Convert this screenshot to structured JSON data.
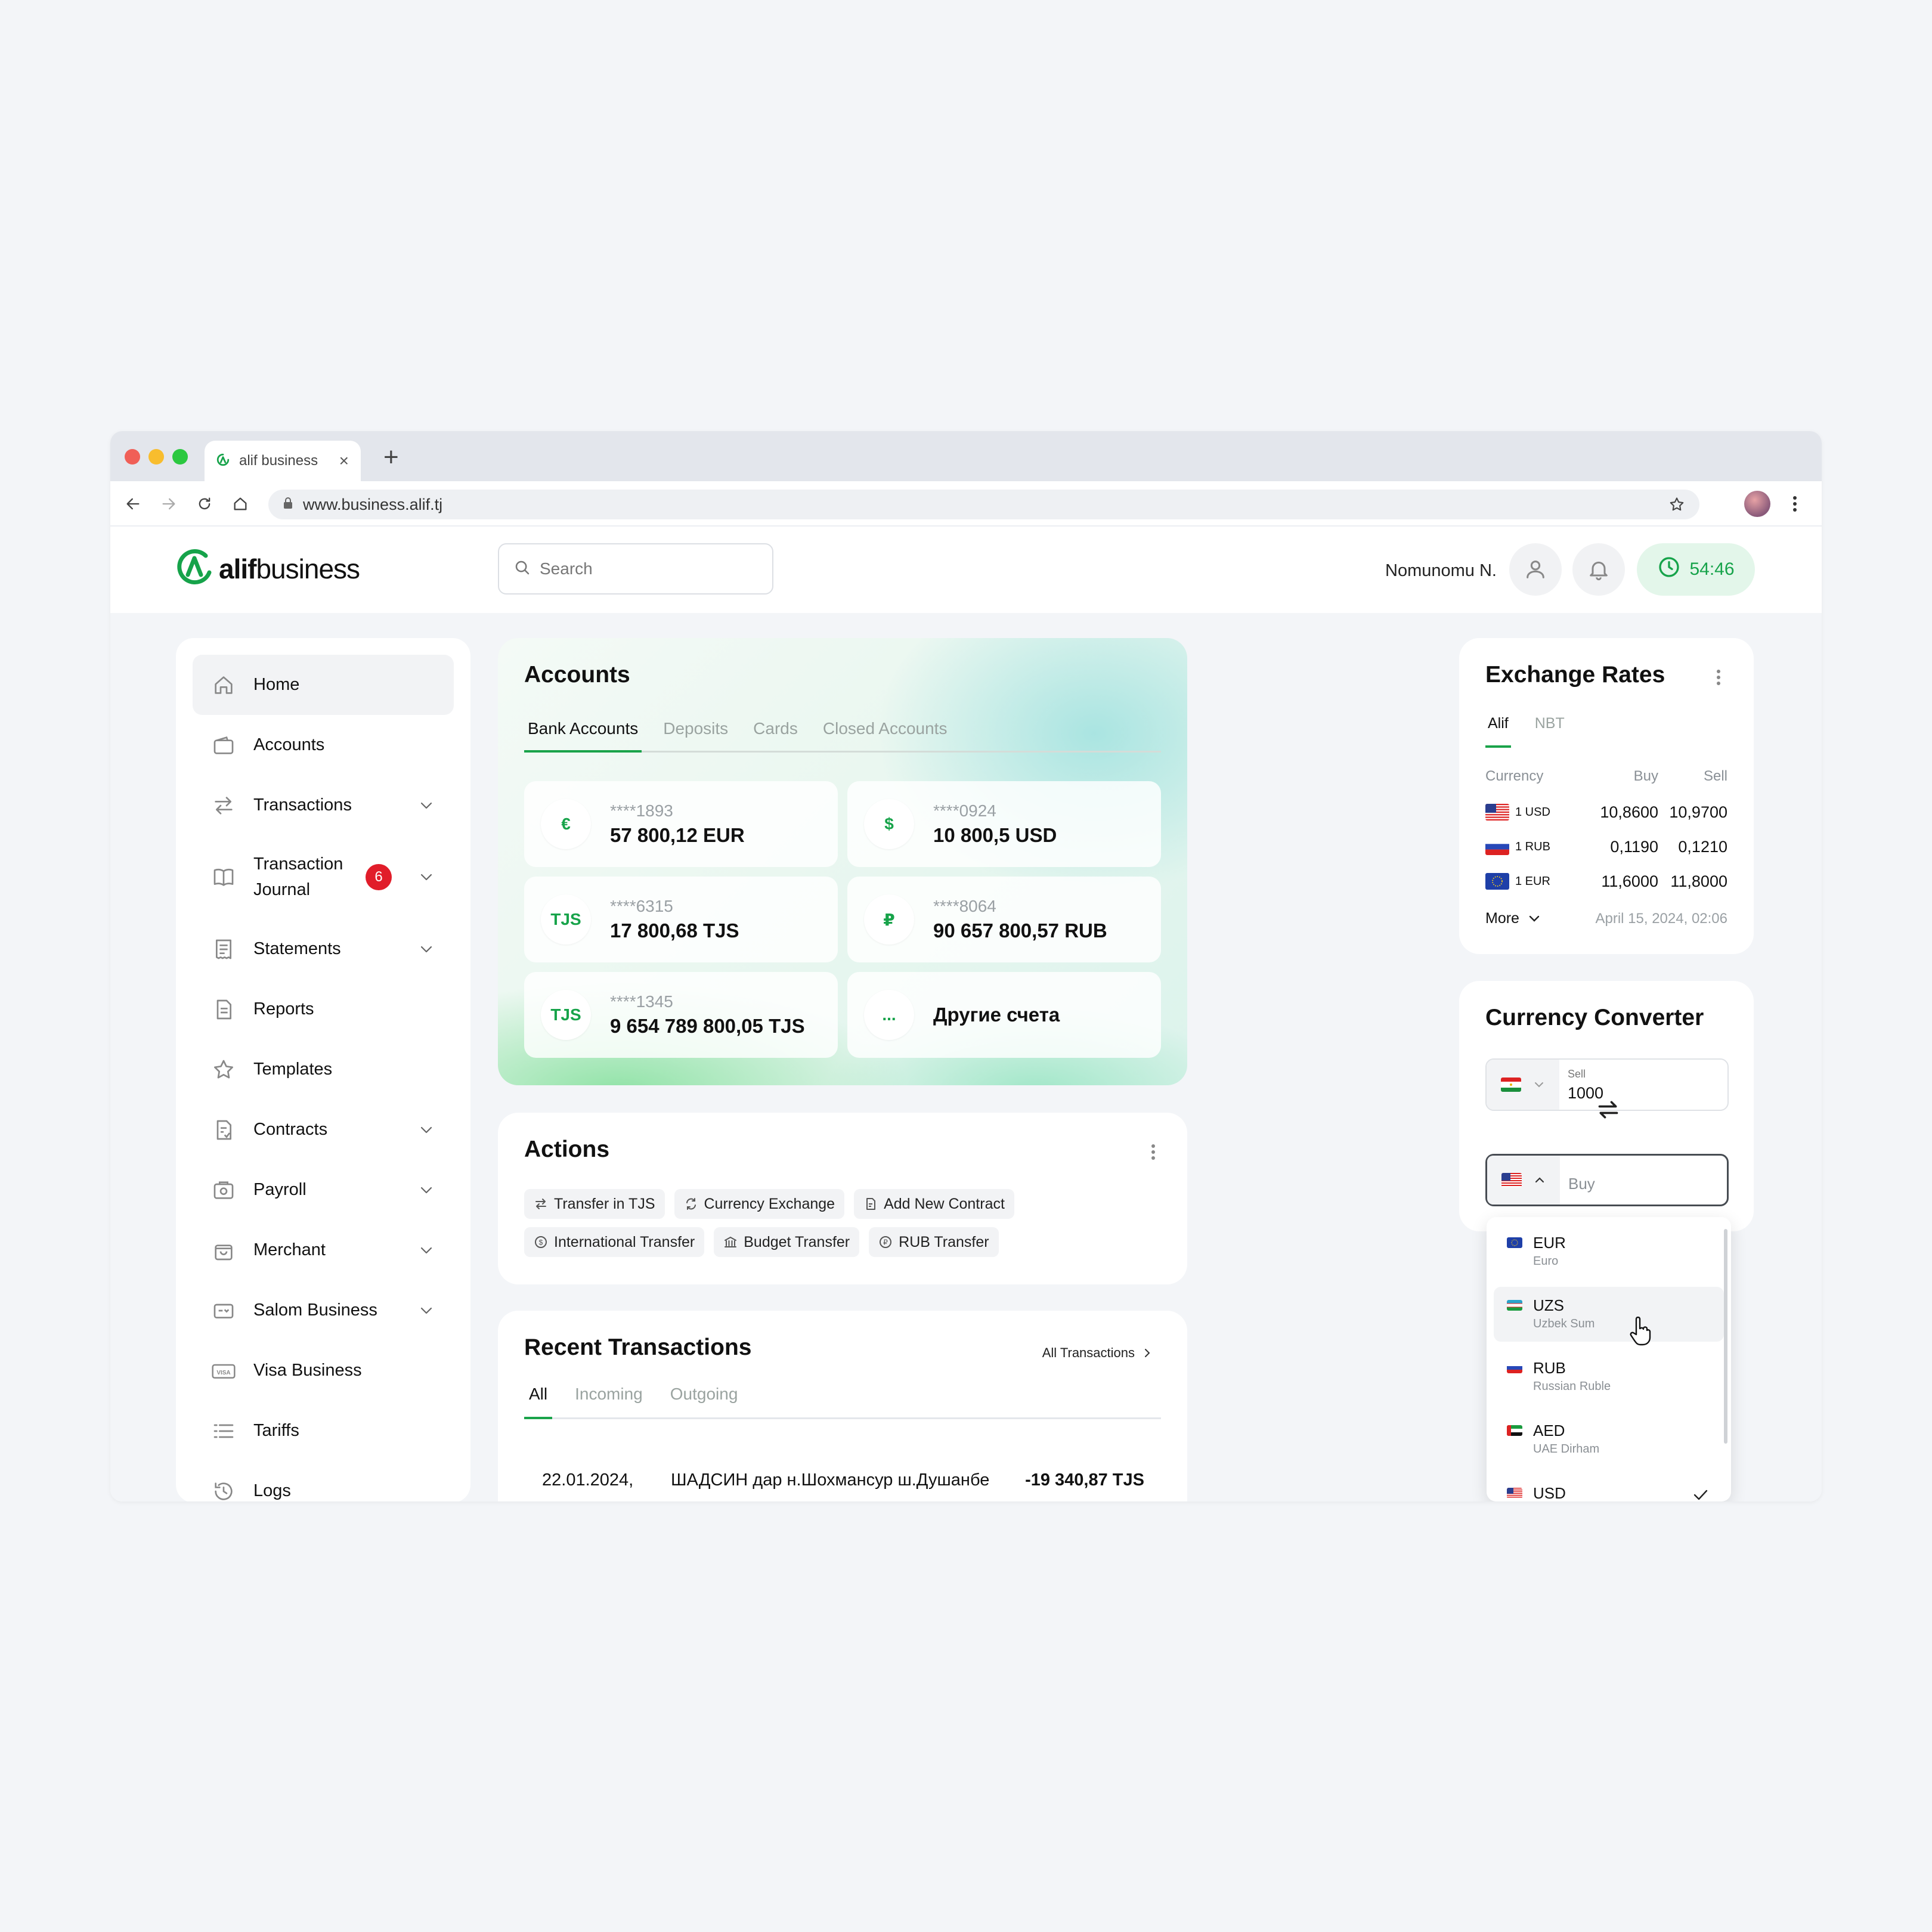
{
  "browser": {
    "tab_title": "alif business",
    "url": "www.business.alif.tj"
  },
  "header": {
    "logo_word1": "alif",
    "logo_word2": "business",
    "search_placeholder": "Search",
    "user_name": "Nomunomu N.",
    "timer": "54:46",
    "brand_color": "#16a34a"
  },
  "sidebar": {
    "items": [
      {
        "label": "Home",
        "icon": "home-icon",
        "active": true
      },
      {
        "label": "Accounts",
        "icon": "wallet-icon"
      },
      {
        "label": "Transactions",
        "icon": "arrows-icon",
        "expandable": true
      },
      {
        "label": "Transaction Journal",
        "icon": "book-icon",
        "expandable": true,
        "badge": "6"
      },
      {
        "label": "Statements",
        "icon": "statement-icon",
        "expandable": true
      },
      {
        "label": "Reports",
        "icon": "report-icon"
      },
      {
        "label": "Templates",
        "icon": "star-icon"
      },
      {
        "label": "Contracts",
        "icon": "contract-icon",
        "expandable": true
      },
      {
        "label": "Payroll",
        "icon": "payroll-icon",
        "expandable": true
      },
      {
        "label": "Merchant",
        "icon": "bag-icon",
        "expandable": true
      },
      {
        "label": "Salom Business",
        "icon": "card-icon",
        "expandable": true
      },
      {
        "label": "Visa Business",
        "icon": "visa-icon"
      },
      {
        "label": "Tariffs",
        "icon": "list-icon"
      },
      {
        "label": "Logs",
        "icon": "history-icon"
      }
    ]
  },
  "accounts": {
    "title": "Accounts",
    "tabs": [
      "Bank Accounts",
      "Deposits",
      "Cards",
      "Closed Accounts"
    ],
    "tiles": [
      {
        "icon": "€",
        "number": "****1893",
        "balance": "57 800,12 EUR"
      },
      {
        "icon": "$",
        "number": "****0924",
        "balance": "10 800,5 USD"
      },
      {
        "icon": "TJS",
        "number": "****6315",
        "balance": "17 800,68 TJS"
      },
      {
        "icon": "₽",
        "number": "****8064",
        "balance": "90 657 800,57 RUB"
      },
      {
        "icon": "TJS",
        "number": "****1345",
        "balance": "9 654 789 800,05 TJS"
      },
      {
        "icon": "...",
        "other": "Другие счета"
      }
    ]
  },
  "actions": {
    "title": "Actions",
    "chips": [
      "Transfer in TJS",
      "Currency Exchange",
      "Add New Contract",
      "International Transfer",
      "Budget Transfer",
      "RUB Transfer"
    ]
  },
  "recent": {
    "title": "Recent Transactions",
    "all_link": "All Transactions",
    "tabs": [
      "All",
      "Incoming",
      "Outgoing"
    ],
    "rows": [
      {
        "date": "22.01.2024,",
        "description": "ШАДСИН дар н.Шохмансур ш.Душанбе",
        "amount": "-19 340,87 TJS"
      }
    ]
  },
  "rates": {
    "title": "Exchange Rates",
    "tabs": [
      "Alif",
      "NBT"
    ],
    "headers": {
      "currency": "Currency",
      "buy": "Buy",
      "sell": "Sell"
    },
    "rows": [
      {
        "flag": "us-flag",
        "currency": "1 USD",
        "buy": "10,8600",
        "sell": "10,9700"
      },
      {
        "flag": "ru-flag",
        "currency": "1 RUB",
        "buy": "0,1190",
        "sell": "0,1210"
      },
      {
        "flag": "eu-flag",
        "currency": "1 EUR",
        "buy": "11,6000",
        "sell": "11,8000"
      }
    ],
    "more": "More",
    "updated": "April 15, 2024, 02:06"
  },
  "converter": {
    "title": "Currency Converter",
    "sell_label": "Sell",
    "sell_value": "1000",
    "buy_placeholder": "Buy"
  },
  "dropdown": {
    "options": [
      {
        "code": "EUR",
        "name": "Euro",
        "flag": "eu-flag"
      },
      {
        "code": "UZS",
        "name": "Uzbek Sum",
        "flag": "uz-flag",
        "hover": true
      },
      {
        "code": "RUB",
        "name": "Russian Ruble",
        "flag": "ru-flag"
      },
      {
        "code": "AED",
        "name": "UAE Dirham",
        "flag": "ae-flag"
      },
      {
        "code": "USD",
        "name": "",
        "flag": "us-flag",
        "selected": true
      }
    ]
  }
}
